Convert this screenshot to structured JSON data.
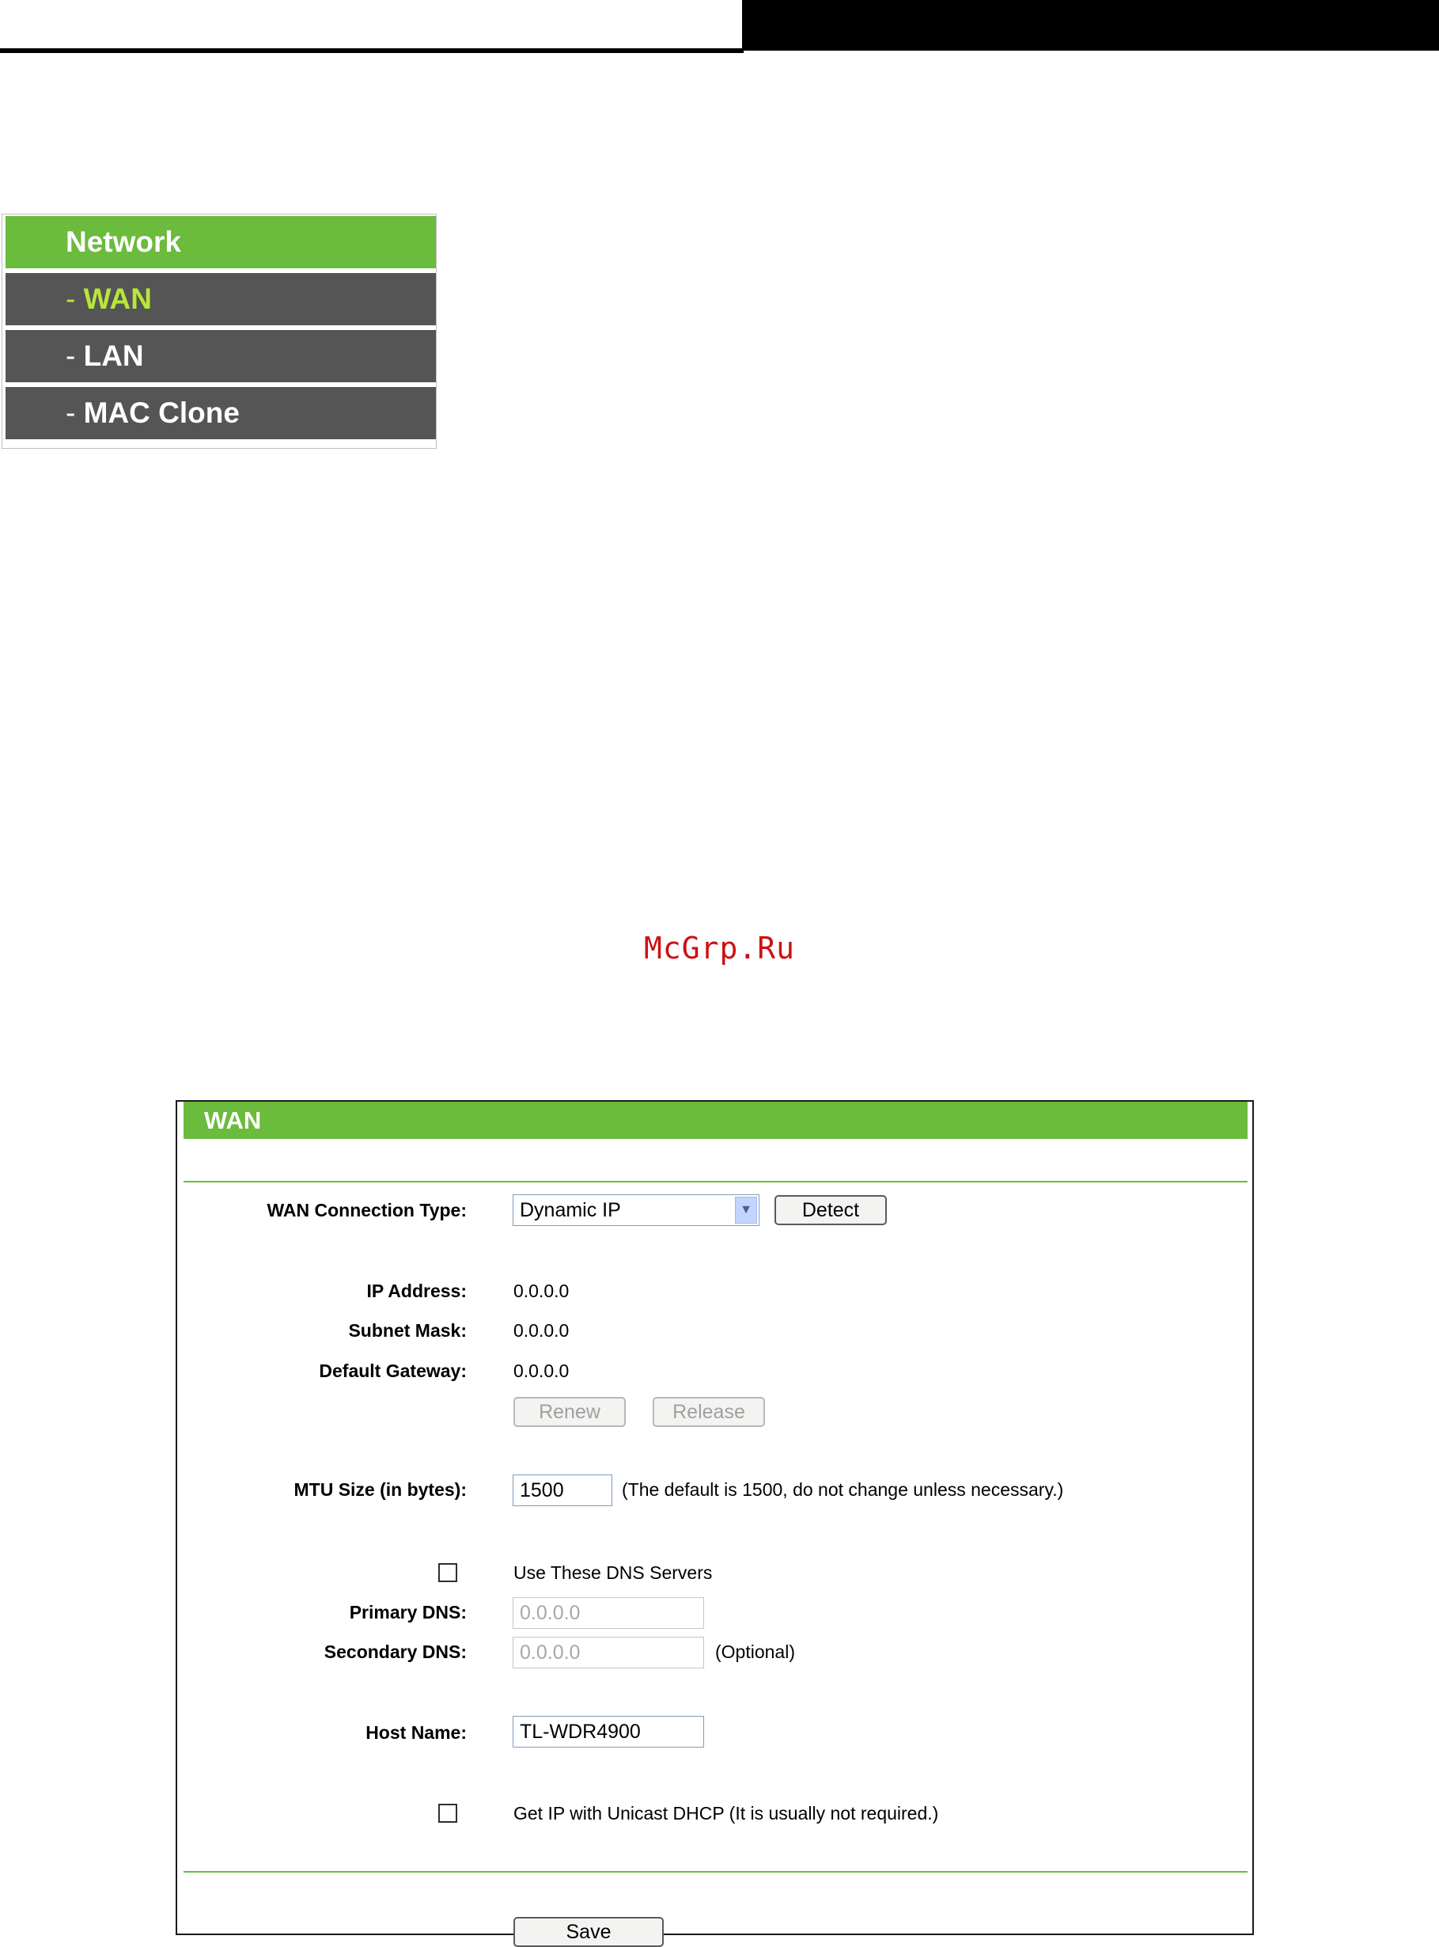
{
  "menu": {
    "header": "Network",
    "items": [
      {
        "dash": "- ",
        "label": "WAN"
      },
      {
        "dash": "- ",
        "label": "LAN"
      },
      {
        "dash": "- ",
        "label": "MAC Clone"
      }
    ]
  },
  "watermark": "McGrp.Ru",
  "wan": {
    "title": "WAN",
    "connection_type_label": "WAN Connection Type:",
    "connection_type_value": "Dynamic IP",
    "detect_label": "Detect",
    "ip_address_label": "IP Address:",
    "ip_address_value": "0.0.0.0",
    "subnet_mask_label": "Subnet Mask:",
    "subnet_mask_value": "0.0.0.0",
    "default_gateway_label": "Default Gateway:",
    "default_gateway_value": "0.0.0.0",
    "renew_label": "Renew",
    "release_label": "Release",
    "mtu_label": "MTU Size (in bytes):",
    "mtu_value": "1500",
    "mtu_note": "(The default is 1500, do not change unless necessary.)",
    "use_dns_label": "Use These DNS Servers",
    "primary_dns_label": "Primary DNS:",
    "primary_dns_value": "0.0.0.0",
    "secondary_dns_label": "Secondary DNS:",
    "secondary_dns_value": "0.0.0.0",
    "optional_note": "(Optional)",
    "host_name_label": "Host Name:",
    "host_name_value": "TL-WDR4900",
    "unicast_label": "Get IP with Unicast DHCP (It is usually not required.)",
    "save_label": "Save"
  },
  "colors": {
    "accent_green": "#6bbb3d",
    "menu_gray": "#555555",
    "active_item": "#b9e63a"
  }
}
